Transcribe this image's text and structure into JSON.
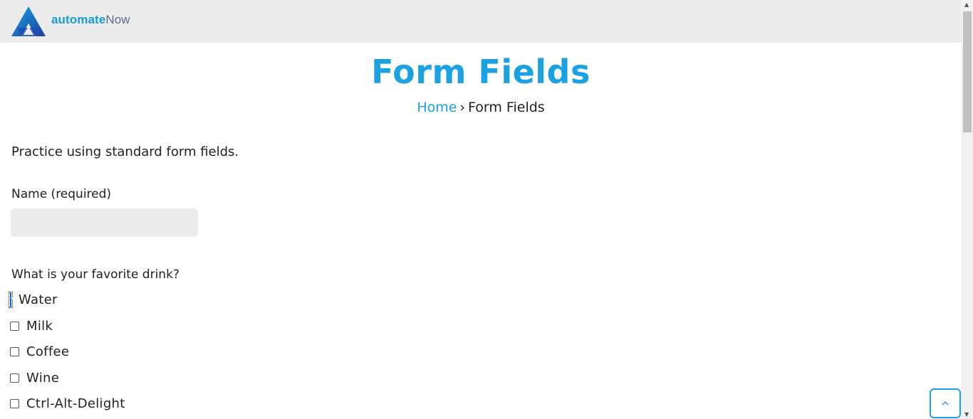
{
  "header": {
    "brand_bold": "automate",
    "brand_light": "Now",
    "logo_icon": "automatenow-logo-icon",
    "background": "#ececec"
  },
  "page": {
    "title": "Form Fields",
    "breadcrumb": {
      "home": "Home",
      "separator": "›",
      "current": "Form Fields"
    },
    "intro": "Practice using standard form fields."
  },
  "form": {
    "name_label": "Name (required)",
    "name_value": "",
    "drink_question": "What is your favorite drink?",
    "drinks": [
      {
        "label": "Water",
        "checked": true
      },
      {
        "label": "Milk",
        "checked": false
      },
      {
        "label": "Coffee",
        "checked": false
      },
      {
        "label": "Wine",
        "checked": false
      },
      {
        "label": "Ctrl-Alt-Delight",
        "checked": false
      }
    ]
  },
  "back_to_top": {
    "icon": "chevron-up-icon"
  },
  "colors": {
    "accent": "#1aa2e3",
    "checkbox_checked": "#0d63d8",
    "input_bg": "#ececec"
  }
}
